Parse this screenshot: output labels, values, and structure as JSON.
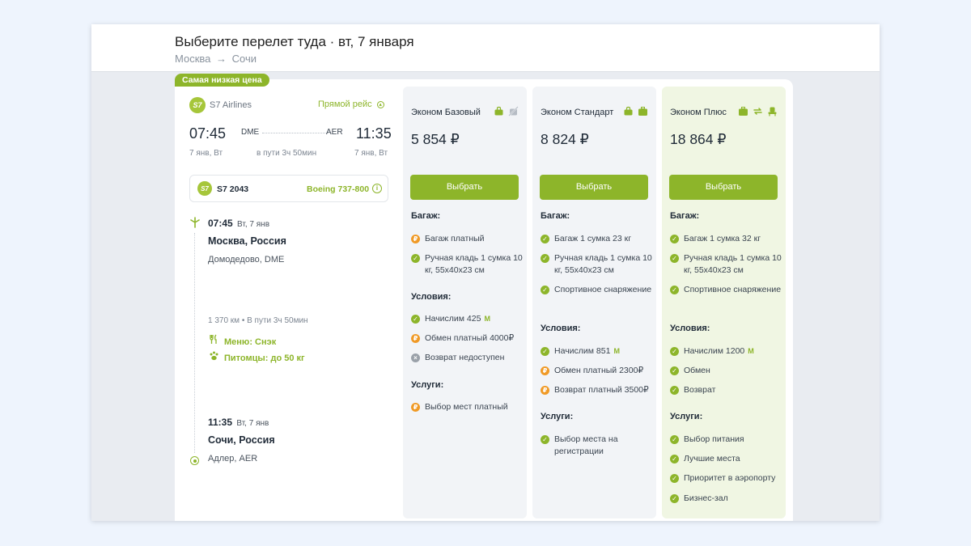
{
  "header": {
    "title": "Выберите перелет туда · вт, 7 января",
    "route_from": "Москва",
    "route_arrow": "→",
    "route_to": "Сочи"
  },
  "badge": "Самая низкая цена",
  "flight": {
    "airline_logo": "S7",
    "airline": "S7 Airlines",
    "direct_label": "Прямой рейс",
    "dep_time": "07:45",
    "dep_code": "DME",
    "arr_code": "AER",
    "arr_time": "11:35",
    "dep_date": "7 янв, Вт",
    "duration": "в пути 3ч 50мин",
    "arr_date": "7 янв, Вт",
    "flight_no": "S7 2043",
    "aircraft": "Boeing 737-800",
    "info_icon": "i",
    "segment": {
      "dep_time": "07:45",
      "dep_day": "Вт, 7 янв",
      "dep_city": "Москва, Россия",
      "dep_airport": "Домодедово, DME",
      "distance": "1 370 км  •  В пути 3ч 50мин",
      "meal": "Меню: Снэк",
      "pets": "Питомцы: до 50 кг",
      "arr_time": "11:35",
      "arr_day": "Вт, 7 янв",
      "arr_city": "Сочи, Россия",
      "arr_airport": "Адлер, AER"
    }
  },
  "fares": [
    {
      "name": "Эконом Базовый",
      "price": "5 854 ₽",
      "button": "Выбрать",
      "baggage_h": "Багаж:",
      "baggage": [
        {
          "status": "paid",
          "text": "Багаж платный"
        },
        {
          "status": "ok",
          "text": "Ручная кладь 1 сумка 10 кг, 55х40х23 см"
        }
      ],
      "conditions_h": "Условия:",
      "conditions": [
        {
          "status": "ok",
          "text": "Начислим 425",
          "miles": "M"
        },
        {
          "status": "paid",
          "text": "Обмен платный 4000₽"
        },
        {
          "status": "no",
          "text": "Возврат недоступен"
        }
      ],
      "services_h": "Услуги:",
      "services": [
        {
          "status": "paid",
          "text": "Выбор мест платный"
        }
      ]
    },
    {
      "name": "Эконом Стандарт",
      "price": "8 824 ₽",
      "button": "Выбрать",
      "baggage_h": "Багаж:",
      "baggage": [
        {
          "status": "ok",
          "text": "Багаж 1 сумка 23 кг"
        },
        {
          "status": "ok",
          "text": "Ручная кладь 1 сумка 10 кг, 55х40х23 см"
        },
        {
          "status": "ok",
          "text": "Спортивное снаряжение"
        }
      ],
      "conditions_h": "Условия:",
      "conditions": [
        {
          "status": "ok",
          "text": "Начислим 851",
          "miles": "M"
        },
        {
          "status": "paid",
          "text": "Обмен платный 2300₽"
        },
        {
          "status": "paid",
          "text": "Возврат платный 3500₽"
        }
      ],
      "services_h": "Услуги:",
      "services": [
        {
          "status": "ok",
          "text": "Выбор места на регистрации"
        }
      ]
    },
    {
      "name": "Эконом Плюс",
      "price": "18 864 ₽",
      "button": "Выбрать",
      "baggage_h": "Багаж:",
      "baggage": [
        {
          "status": "ok",
          "text": "Багаж 1 сумка 32 кг"
        },
        {
          "status": "ok",
          "text": "Ручная кладь 1 сумка 10 кг, 55х40х23 см"
        },
        {
          "status": "ok",
          "text": "Спортивное снаряжение"
        }
      ],
      "conditions_h": "Условия:",
      "conditions": [
        {
          "status": "ok",
          "text": "Начислим 1200",
          "miles": "M"
        },
        {
          "status": "ok",
          "text": "Обмен"
        },
        {
          "status": "ok",
          "text": "Возврат"
        }
      ],
      "services_h": "Услуги:",
      "services": [
        {
          "status": "ok",
          "text": "Выбор питания"
        },
        {
          "status": "ok",
          "text": "Лучшие места"
        },
        {
          "status": "ok",
          "text": "Приоритет в аэропорту"
        },
        {
          "status": "ok",
          "text": "Бизнес-зал"
        }
      ]
    }
  ],
  "colors": {
    "accent": "#8db52a",
    "paid": "#f09a26",
    "unavailable": "#9aa1a9",
    "plus_bg": "#f0f6e3"
  }
}
